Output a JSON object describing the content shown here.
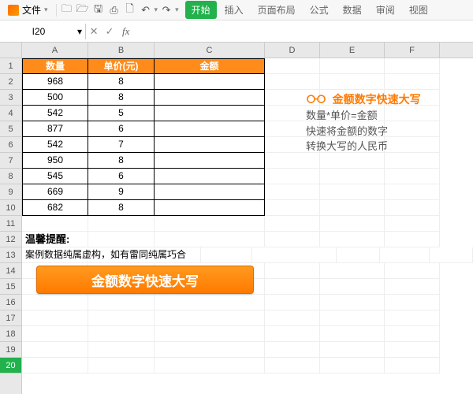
{
  "menubar": {
    "file_label": "文件",
    "tabs": [
      "开始",
      "插入",
      "页面布局",
      "公式",
      "数据",
      "审阅",
      "视图"
    ],
    "active_tab": 0
  },
  "namebox": {
    "value": "I20"
  },
  "formula": {
    "value": ""
  },
  "colheaders": [
    "A",
    "B",
    "C",
    "D",
    "E",
    "F"
  ],
  "rowheaders": [
    "1",
    "2",
    "3",
    "4",
    "5",
    "6",
    "7",
    "8",
    "9",
    "10",
    "11",
    "12",
    "13",
    "14",
    "15",
    "16",
    "17",
    "18",
    "19",
    "20"
  ],
  "table": {
    "headers": [
      "数量",
      "单价(元)",
      "金额"
    ],
    "rows": [
      [
        "968",
        "8",
        ""
      ],
      [
        "500",
        "8",
        ""
      ],
      [
        "542",
        "5",
        ""
      ],
      [
        "877",
        "6",
        ""
      ],
      [
        "542",
        "7",
        ""
      ],
      [
        "950",
        "8",
        ""
      ],
      [
        "545",
        "6",
        ""
      ],
      [
        "669",
        "9",
        ""
      ],
      [
        "682",
        "8",
        ""
      ]
    ]
  },
  "note": {
    "title": "温馨提醒:",
    "body": "案例数据纯属虚构，如有雷同纯属巧合"
  },
  "big_button": "金额数字快速大写",
  "side": {
    "title": "金额数字快速大写",
    "line1": "数量*单价=金额",
    "line2": "快速将金额的数字",
    "line3": "转换大写的人民币"
  },
  "active_row": 20
}
